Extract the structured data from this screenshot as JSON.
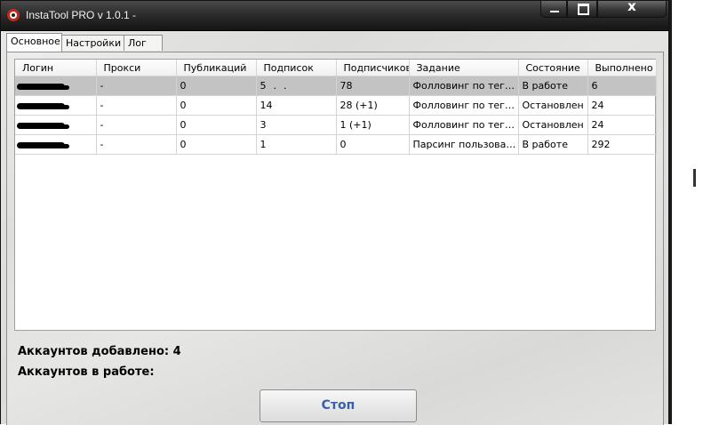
{
  "window": {
    "title": "InstaTool PRO v 1.0.1 -",
    "close_glyph": "x"
  },
  "tabs": [
    {
      "label": "Основное",
      "active": true
    },
    {
      "label": "Настройки",
      "active": false
    },
    {
      "label": "Лог",
      "active": false
    }
  ],
  "table": {
    "columns": [
      "Логин",
      "Прокси",
      "Публикаций",
      "Подписок",
      "Подписчиков",
      "Задание",
      "Состояние",
      "Выполнено"
    ],
    "rows": [
      {
        "proxy": "-",
        "posts": "0",
        "following": "5",
        "followers": "78",
        "task": "Фолловинг по тегам",
        "state": "В работе",
        "done": "6",
        "selected": true
      },
      {
        "proxy": "-",
        "posts": "0",
        "following": "14",
        "followers": "28 (+1)",
        "task": "Фолловинг по тегам",
        "state": "Остановлен",
        "done": "24",
        "selected": false
      },
      {
        "proxy": "-",
        "posts": "0",
        "following": "3",
        "followers": "1 (+1)",
        "task": "Фолловинг по тегам",
        "state": "Остановлен",
        "done": "24",
        "selected": false
      },
      {
        "proxy": "-",
        "posts": "0",
        "following": "1",
        "followers": "0",
        "task": "Парсинг пользовате...",
        "state": "В работе",
        "done": "292",
        "selected": false
      }
    ]
  },
  "status": {
    "accounts_added": "Аккаунтов добавлено: 4",
    "accounts_working": "Аккаунтов в работе:"
  },
  "buttons": {
    "stop_label": "Стоп"
  },
  "icons": {
    "app": "app-logo-icon",
    "minimize": "minimize-icon",
    "maximize": "maximize-icon",
    "close": "close-icon"
  }
}
